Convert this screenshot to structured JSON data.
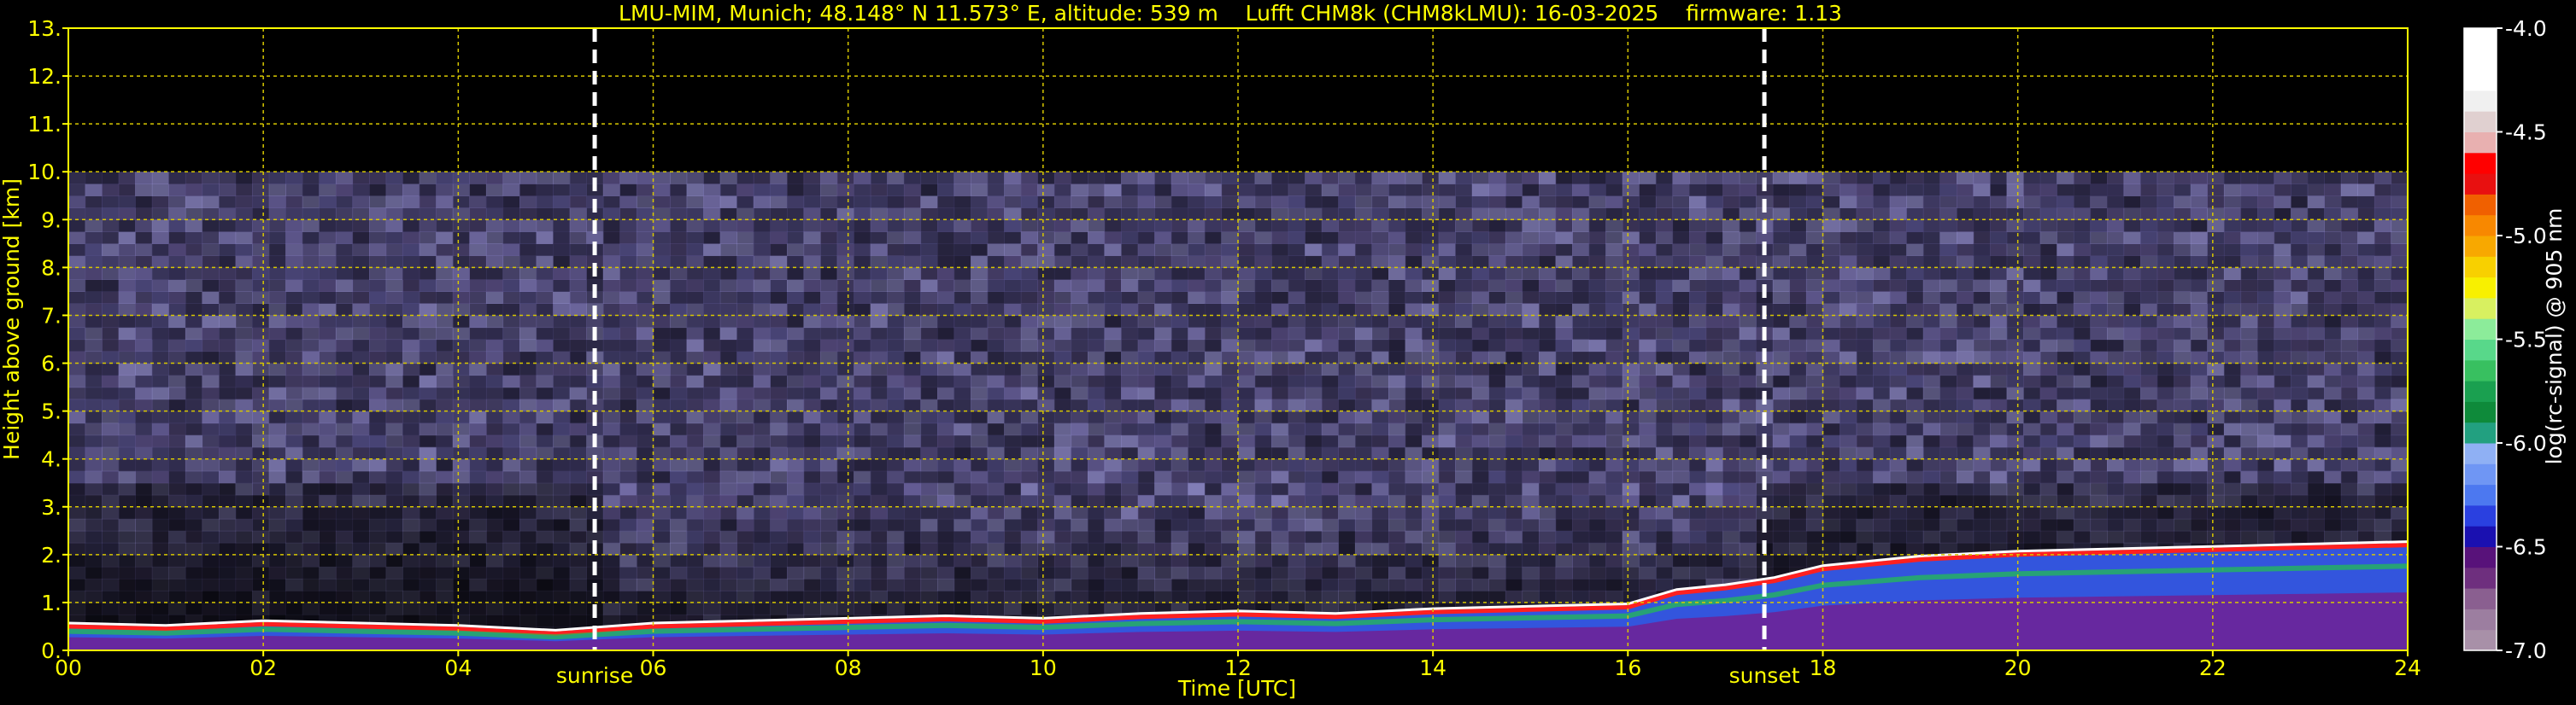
{
  "chart_data": {
    "type": "heatmap",
    "title": "LMU-MIM, Munich; 48.148° N 11.573° E, altitude: 539 m    Lufft CHM8k (CHM8kLMU): 16-03-2025    firmware: 1.13",
    "xlabel": "Time [UTC]",
    "ylabel": "Height above ground [km]",
    "xlim": [
      0,
      24
    ],
    "ylim": [
      0,
      13
    ],
    "x_ticks": [
      "00",
      "02",
      "04",
      "06",
      "08",
      "10",
      "12",
      "14",
      "16",
      "18",
      "20",
      "22",
      "24"
    ],
    "y_ticks": [
      "0.",
      "1.",
      "2.",
      "3.",
      "4.",
      "5.",
      "6.",
      "7.",
      "8.",
      "9.",
      "10.",
      "11.",
      "12.",
      "13."
    ],
    "grid": true,
    "colorbar": {
      "label": "log(rc-signal) @ 905 nm",
      "range": [
        -7.0,
        -4.0
      ],
      "ticks": [
        "-4.0",
        "-4.5",
        "-5.0",
        "-5.5",
        "-6.0",
        "-6.5",
        "-7.0"
      ]
    },
    "markers": [
      {
        "label": "sunrise",
        "time_utc": 5.4
      },
      {
        "label": "sunset",
        "time_utc": 17.4
      }
    ],
    "signal_top_km": 10.0,
    "boundary_layer_top_km": [
      [
        0,
        0.5
      ],
      [
        1,
        0.45
      ],
      [
        2,
        0.55
      ],
      [
        3,
        0.5
      ],
      [
        4,
        0.45
      ],
      [
        5,
        0.35
      ],
      [
        6,
        0.5
      ],
      [
        7,
        0.55
      ],
      [
        8,
        0.6
      ],
      [
        9,
        0.65
      ],
      [
        10,
        0.6
      ],
      [
        11,
        0.7
      ],
      [
        12,
        0.75
      ],
      [
        13,
        0.7
      ],
      [
        14,
        0.8
      ],
      [
        15,
        0.85
      ],
      [
        16,
        0.9
      ],
      [
        16.5,
        1.2
      ],
      [
        17,
        1.3
      ],
      [
        17.5,
        1.45
      ],
      [
        18,
        1.7
      ],
      [
        19,
        1.9
      ],
      [
        20,
        2.0
      ],
      [
        21,
        2.05
      ],
      [
        22,
        2.1
      ],
      [
        23,
        2.15
      ],
      [
        24,
        2.2
      ]
    ]
  }
}
